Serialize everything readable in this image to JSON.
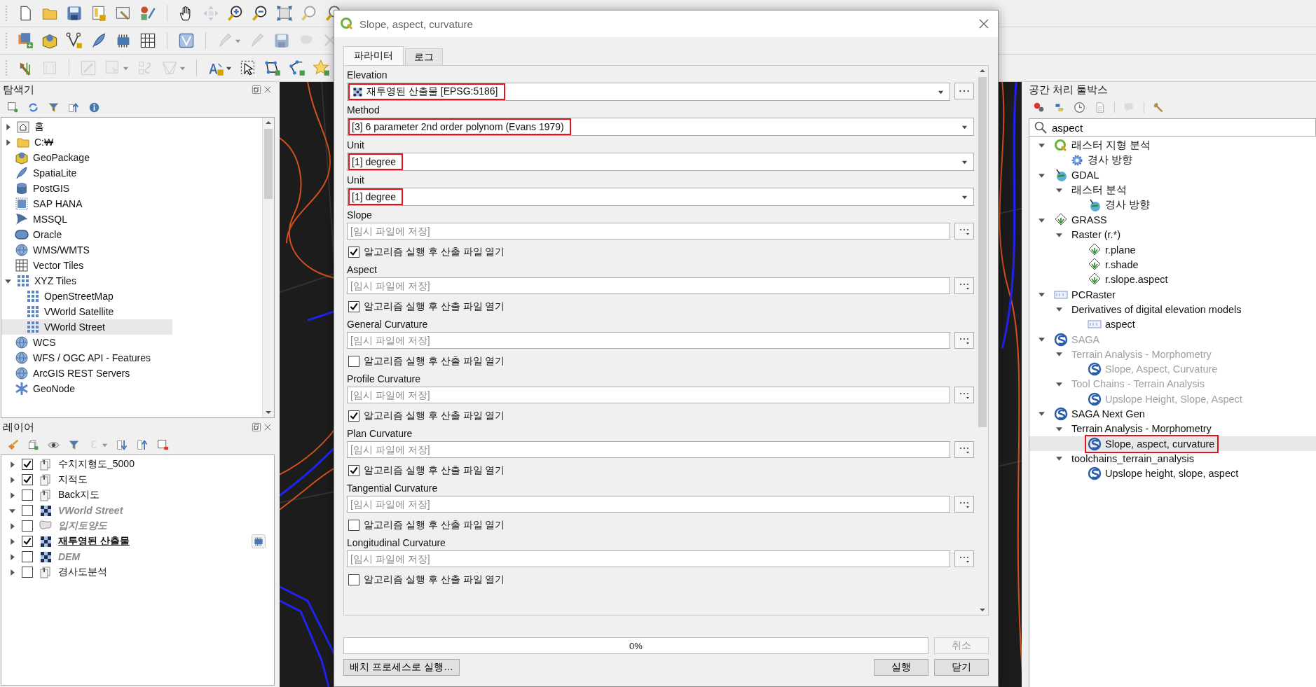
{
  "browser": {
    "title": "탐색기",
    "items": [
      {
        "label": "홈",
        "kind": "branch",
        "expanded": false,
        "selected": false
      },
      {
        "label": "C:₩",
        "kind": "branch",
        "expanded": false,
        "selected": false
      },
      {
        "label": "GeoPackage",
        "kind": "leaf",
        "selected": false
      },
      {
        "label": "SpatiaLite",
        "kind": "leaf",
        "selected": false
      },
      {
        "label": "PostGIS",
        "kind": "leaf",
        "selected": false
      },
      {
        "label": "SAP HANA",
        "kind": "leaf",
        "selected": false
      },
      {
        "label": "MSSQL",
        "kind": "leaf",
        "selected": false
      },
      {
        "label": "Oracle",
        "kind": "leaf",
        "selected": false
      },
      {
        "label": "WMS/WMTS",
        "kind": "leaf",
        "selected": false
      },
      {
        "label": "Vector Tiles",
        "kind": "leaf",
        "selected": false
      },
      {
        "label": "XYZ Tiles",
        "kind": "branch",
        "expanded": true,
        "selected": false,
        "children": [
          {
            "label": "OpenStreetMap",
            "kind": "leaf",
            "selected": false
          },
          {
            "label": "VWorld Satellite",
            "kind": "leaf",
            "selected": false
          },
          {
            "label": "VWorld Street",
            "kind": "leaf",
            "selected": true
          }
        ]
      },
      {
        "label": "WCS",
        "kind": "leaf",
        "selected": false
      },
      {
        "label": "WFS / OGC API - Features",
        "kind": "leaf",
        "selected": false
      },
      {
        "label": "ArcGIS REST Servers",
        "kind": "leaf",
        "selected": false
      },
      {
        "label": "GeoNode",
        "kind": "leaf",
        "selected": false
      }
    ]
  },
  "layers": {
    "title": "레이어",
    "items": [
      {
        "label": "수치지형도_5000",
        "kind": "group",
        "expanded": false,
        "checked": true,
        "dimmed": false,
        "current": false,
        "temporary": false
      },
      {
        "label": "지적도",
        "kind": "group",
        "expanded": false,
        "checked": true,
        "dimmed": false,
        "current": false,
        "temporary": false
      },
      {
        "label": "Back지도",
        "kind": "group",
        "expanded": false,
        "checked": false,
        "dimmed": false,
        "current": false,
        "temporary": false
      },
      {
        "label": "VWorld Street",
        "kind": "raster",
        "expanded": true,
        "checked": false,
        "dimmed": true,
        "current": false,
        "temporary": false
      },
      {
        "label": "입지토양도",
        "kind": "polygon",
        "expanded": false,
        "checked": false,
        "dimmed": true,
        "current": false,
        "temporary": false
      },
      {
        "label": "재투영된 산출물",
        "kind": "raster",
        "expanded": false,
        "checked": true,
        "dimmed": false,
        "current": true,
        "temporary": true
      },
      {
        "label": "DEM",
        "kind": "raster",
        "expanded": false,
        "checked": false,
        "dimmed": true,
        "current": false,
        "temporary": false
      },
      {
        "label": "경사도분석",
        "kind": "group",
        "expanded": false,
        "checked": false,
        "dimmed": false,
        "current": false,
        "temporary": false
      }
    ]
  },
  "dialog": {
    "title": "Slope, aspect, curvature",
    "tabs": [
      {
        "label": "파라미터",
        "selected": true
      },
      {
        "label": "로그",
        "selected": false
      }
    ],
    "parameters": [
      {
        "kind": "layer",
        "label": "Elevation",
        "value": "재투영된 산출물 [EPSG:5186]",
        "highlighted": true
      },
      {
        "kind": "choice",
        "label": "Method",
        "value": "[3] 6 parameter 2nd order polynom (Evans 1979)",
        "highlighted": true
      },
      {
        "kind": "choice",
        "label": "Unit",
        "value": "[1] degree",
        "highlighted": true
      },
      {
        "kind": "choice",
        "label": "Unit",
        "value": "[1] degree",
        "highlighted": true
      },
      {
        "kind": "output",
        "label": "Slope",
        "placeholder": "[임시 파일에 저장]",
        "open_label": "알고리즘 실행 후 산출 파일 열기",
        "open_after": true
      },
      {
        "kind": "output",
        "label": "Aspect",
        "placeholder": "[임시 파일에 저장]",
        "open_label": "알고리즘 실행 후 산출 파일 열기",
        "open_after": true
      },
      {
        "kind": "output",
        "label": "General Curvature",
        "placeholder": "[임시 파일에 저장]",
        "open_label": "알고리즘 실행 후 산출 파일 열기",
        "open_after": false
      },
      {
        "kind": "output",
        "label": "Profile Curvature",
        "placeholder": "[임시 파일에 저장]",
        "open_label": "알고리즘 실행 후 산출 파일 열기",
        "open_after": true
      },
      {
        "kind": "output",
        "label": "Plan Curvature",
        "placeholder": "[임시 파일에 저장]",
        "open_label": "알고리즘 실행 후 산출 파일 열기",
        "open_after": true
      },
      {
        "kind": "output",
        "label": "Tangential Curvature",
        "placeholder": "[임시 파일에 저장]",
        "open_label": "알고리즘 실행 후 산출 파일 열기",
        "open_after": false
      },
      {
        "kind": "output",
        "label": "Longitudinal Curvature",
        "placeholder": "[임시 파일에 저장]",
        "open_label": "알고리즘 실행 후 산출 파일 열기",
        "open_after": false
      }
    ],
    "progress": {
      "level": 0,
      "reading": "0%"
    },
    "cancel": {
      "label": "취소",
      "disabled": true
    },
    "batch_button": "배치 프로세스로 실행…",
    "run_button": "실행",
    "close_button": "닫기"
  },
  "toolbox": {
    "title": "공간 처리 툴박스",
    "search": {
      "value": "aspect"
    },
    "items": [
      {
        "label": "래스터 지형 분석",
        "kind": "branch",
        "expanded": true,
        "disabled": false,
        "selected": false,
        "highlighted": false,
        "children": [
          {
            "label": "경사 방향",
            "kind": "leaf",
            "disabled": false,
            "selected": false,
            "highlighted": false
          }
        ]
      },
      {
        "label": "GDAL",
        "kind": "branch",
        "expanded": true,
        "disabled": false,
        "selected": false,
        "highlighted": false,
        "children": [
          {
            "label": "래스터 분석",
            "kind": "branch",
            "expanded": true,
            "disabled": false,
            "selected": false,
            "highlighted": false,
            "children": [
              {
                "label": "경사 방향",
                "kind": "leaf",
                "disabled": false,
                "selected": false,
                "highlighted": false
              }
            ]
          }
        ]
      },
      {
        "label": "GRASS",
        "kind": "branch",
        "expanded": true,
        "disabled": false,
        "selected": false,
        "highlighted": false,
        "children": [
          {
            "label": "Raster (r.*)",
            "kind": "branch",
            "expanded": true,
            "disabled": false,
            "selected": false,
            "highlighted": false,
            "children": [
              {
                "label": "r.plane",
                "kind": "leaf",
                "disabled": false,
                "selected": false,
                "highlighted": false
              },
              {
                "label": "r.shade",
                "kind": "leaf",
                "disabled": false,
                "selected": false,
                "highlighted": false
              },
              {
                "label": "r.slope.aspect",
                "kind": "leaf",
                "disabled": false,
                "selected": false,
                "highlighted": false
              }
            ]
          }
        ]
      },
      {
        "label": "PCRaster",
        "kind": "branch",
        "expanded": true,
        "disabled": false,
        "selected": false,
        "highlighted": false,
        "children": [
          {
            "label": "Derivatives of digital elevation models",
            "kind": "branch",
            "expanded": true,
            "disabled": false,
            "selected": false,
            "highlighted": false,
            "children": [
              {
                "label": "aspect",
                "kind": "leaf",
                "disabled": false,
                "selected": false,
                "highlighted": false
              }
            ]
          }
        ]
      },
      {
        "label": "SAGA",
        "kind": "branch",
        "expanded": true,
        "disabled": true,
        "selected": false,
        "highlighted": false,
        "children": [
          {
            "label": "Terrain Analysis - Morphometry",
            "kind": "branch",
            "expanded": true,
            "disabled": true,
            "selected": false,
            "highlighted": false,
            "children": [
              {
                "label": "Slope, Aspect, Curvature",
                "kind": "leaf",
                "disabled": true,
                "selected": false,
                "highlighted": false
              }
            ]
          },
          {
            "label": "Tool Chains - Terrain Analysis",
            "kind": "branch",
            "expanded": true,
            "disabled": true,
            "selected": false,
            "highlighted": false,
            "children": [
              {
                "label": "Upslope Height, Slope, Aspect",
                "kind": "leaf",
                "disabled": true,
                "selected": false,
                "highlighted": false
              }
            ]
          }
        ]
      },
      {
        "label": "SAGA Next Gen",
        "kind": "branch",
        "expanded": true,
        "disabled": false,
        "selected": false,
        "highlighted": false,
        "children": [
          {
            "label": "Terrain Analysis - Morphometry",
            "kind": "branch",
            "expanded": true,
            "disabled": false,
            "selected": false,
            "highlighted": false,
            "children": [
              {
                "label": "Slope, aspect, curvature",
                "kind": "leaf",
                "disabled": false,
                "selected": true,
                "highlighted": true
              }
            ]
          },
          {
            "label": "toolchains_terrain_analysis",
            "kind": "branch",
            "expanded": true,
            "disabled": false,
            "selected": false,
            "highlighted": false,
            "children": [
              {
                "label": "Upslope height, slope, aspect",
                "kind": "leaf",
                "disabled": false,
                "selected": false,
                "highlighted": false
              }
            ]
          }
        ]
      }
    ]
  }
}
